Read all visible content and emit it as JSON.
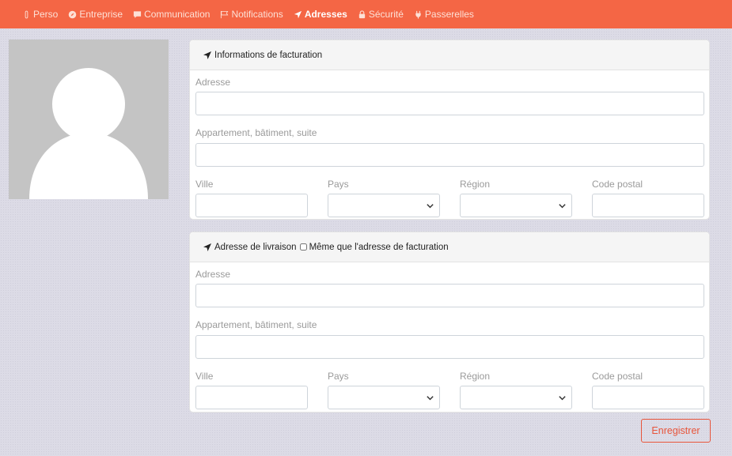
{
  "nav": {
    "items": [
      {
        "label": "Perso",
        "icon": "user-icon"
      },
      {
        "label": "Entreprise",
        "icon": "compass-icon"
      },
      {
        "label": "Communication",
        "icon": "comment-icon"
      },
      {
        "label": "Notifications",
        "icon": "flag-icon"
      },
      {
        "label": "Adresses",
        "icon": "location-arrow-icon",
        "active": true
      },
      {
        "label": "Sécurité",
        "icon": "lock-icon"
      },
      {
        "label": "Passerelles",
        "icon": "plug-icon"
      }
    ],
    "bg_color": "#f46645"
  },
  "billing": {
    "title": "Informations de facturation",
    "address_label": "Adresse",
    "address2_label": "Appartement, bâtiment, suite",
    "city_label": "Ville",
    "country_label": "Pays",
    "region_label": "Région",
    "postal_label": "Code postal",
    "address_value": "",
    "address2_value": "",
    "city_value": "",
    "country_value": "",
    "region_value": "",
    "postal_value": ""
  },
  "shipping": {
    "title": "Adresse de livraison",
    "same_as_billing_label": "Même que l'adresse de facturation",
    "same_as_billing_checked": false,
    "address_label": "Adresse",
    "address2_label": "Appartement, bâtiment, suite",
    "city_label": "Ville",
    "country_label": "Pays",
    "region_label": "Région",
    "postal_label": "Code postal",
    "address_value": "",
    "address2_value": "",
    "city_value": "",
    "country_value": "",
    "region_value": "",
    "postal_value": ""
  },
  "actions": {
    "save_label": "Enregistrer",
    "save_color": "#e8553b"
  }
}
